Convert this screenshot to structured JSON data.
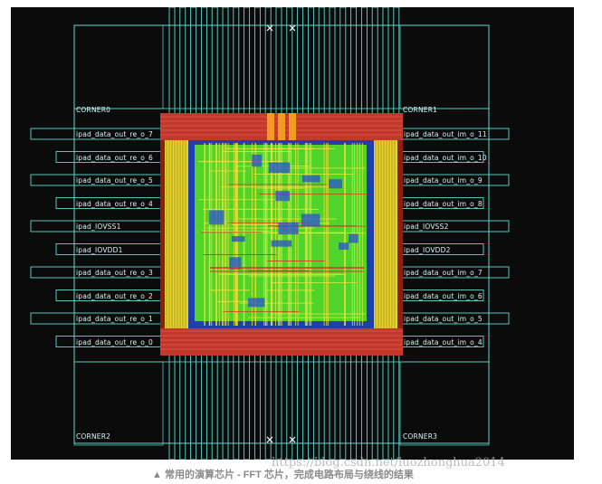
{
  "layout": {
    "corners": {
      "top_left": "CORNER0",
      "top_right": "CORNER1",
      "bottom_left": "CORNER2",
      "bottom_right": "CORNER3"
    },
    "left_pads": [
      "ipad_data_out_re_o_7",
      "ipad_data_out_re_o_6",
      "ipad_data_out_re_o_5",
      "ipad_data_out_re_o_4",
      "ipad_IOVSS1",
      "ipad_IOVDD1",
      "ipad_data_out_re_o_3",
      "ipad_data_out_re_o_2",
      "ipad_data_out_re_o_1",
      "ipad_data_out_re_o_0"
    ],
    "right_pads": [
      "ipad_data_out_im_o_11",
      "ipad_data_out_im_o_10",
      "ipad_data_out_im_o_9",
      "ipad_data_out_im_o_8",
      "ipad_IOVSS2",
      "ipad_IOVDD2",
      "ipad_data_out_im_o_7",
      "ipad_data_out_im_o_6",
      "ipad_data_out_im_o_5",
      "ipad_data_out_im_o_4"
    ],
    "colors": {
      "background": "#0b0b0b",
      "pad_outline": "#5fd9cf",
      "power_ring": "#c0392b",
      "side_rails": "#e5d22e",
      "core_fill": "#1f3fae",
      "cell_green": "#4fd42a",
      "route_yellow": "#f0e23a"
    }
  },
  "caption": {
    "text": "▲ 常用的演算芯片 - FFT 芯片，完成电路布局与绕线的结果",
    "watermark": "https://blog.csdn.net/luozhonghua2014"
  }
}
